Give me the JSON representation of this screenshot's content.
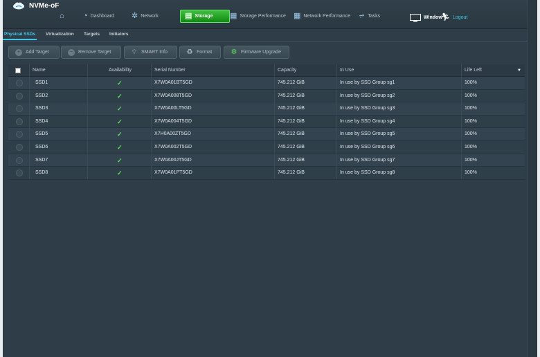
{
  "app": {
    "title": "NVMe-oF"
  },
  "nav": {
    "home_icon": "home-icon",
    "items": [
      {
        "label": "Dashboard",
        "icon": "gauge-icon"
      },
      {
        "label": "Network",
        "icon": "network-icon"
      },
      {
        "label": "Storage",
        "icon": "storage-icon",
        "active": true
      },
      {
        "label": "Storage Performance",
        "icon": "chart-icon"
      },
      {
        "label": "Network Performance",
        "icon": "chart-icon"
      },
      {
        "label": "Tasks",
        "icon": "tasks-icon"
      }
    ],
    "window_label": "Window",
    "logout_label": "Logout"
  },
  "subtabs": [
    {
      "label": "Physical SSDs",
      "active": true
    },
    {
      "label": "Virtualization"
    },
    {
      "label": "Targets"
    },
    {
      "label": "Initiators"
    }
  ],
  "toolbar": {
    "add_target": "Add Target",
    "remove_target": "Remove Target",
    "smart_info": "SMART Info",
    "format": "Format",
    "firmware_upgrade": "Firmware Upgrade"
  },
  "table": {
    "columns": [
      "Name",
      "Availability",
      "Serial Number",
      "Capacity",
      "In Use",
      "Life Left"
    ],
    "rows": [
      {
        "name": "SSD1",
        "availability": "✓",
        "serial": "X7W0A01BT5GD",
        "capacity": "745.212 GiB",
        "in_use": "In use by SSD Group sg1",
        "life": "100%"
      },
      {
        "name": "SSD2",
        "availability": "✓",
        "serial": "X7W0A008T5GD",
        "capacity": "745.212 GiB",
        "in_use": "In use by SSD Group sg2",
        "life": "100%"
      },
      {
        "name": "SSD3",
        "availability": "✓",
        "serial": "X7W0A00LT5GD",
        "capacity": "745.212 GiB",
        "in_use": "In use by SSD Group sg3",
        "life": "100%"
      },
      {
        "name": "SSD4",
        "availability": "✓",
        "serial": "X7W0A004T5GD",
        "capacity": "745.212 GiB",
        "in_use": "In use by SSD Group sg4",
        "life": "100%"
      },
      {
        "name": "SSD5",
        "availability": "✓",
        "serial": "X7H0A00ZT5GD",
        "capacity": "745.212 GiB",
        "in_use": "In use by SSD Group sg5",
        "life": "100%"
      },
      {
        "name": "SSD6",
        "availability": "✓",
        "serial": "X7W0A002T5GD",
        "capacity": "745.212 GiB",
        "in_use": "In use by SSD Group sg6",
        "life": "100%"
      },
      {
        "name": "SSD7",
        "availability": "✓",
        "serial": "X7W0A00JT5GD",
        "capacity": "745.212 GiB",
        "in_use": "In use by SSD Group sg7",
        "life": "100%"
      },
      {
        "name": "SSD8",
        "availability": "✓",
        "serial": "X7W0A01PT5GD",
        "capacity": "745.212 GiB",
        "in_use": "In use by SSD Group sg8",
        "life": "100%"
      }
    ]
  },
  "colors": {
    "accent": "#41c8ea",
    "active_nav": "#1f9a1f",
    "check": "#5be05b"
  }
}
